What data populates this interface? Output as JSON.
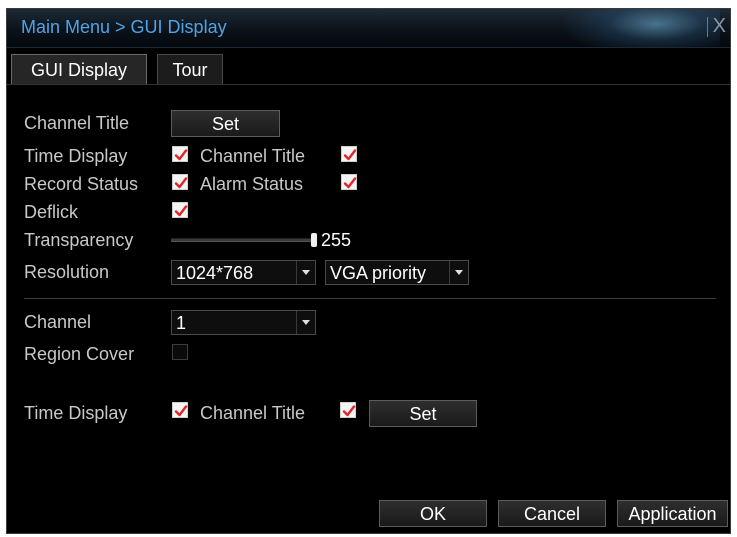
{
  "window": {
    "title": "Main Menu > GUI Display",
    "close_label": "X"
  },
  "tabs": [
    {
      "label": "GUI Display",
      "active": true
    },
    {
      "label": "Tour",
      "active": false
    }
  ],
  "global": {
    "channel_title_label": "Channel Title",
    "channel_title_button": "Set",
    "time_display_label": "Time Display",
    "time_display_checked": true,
    "channel_title_check_label": "Channel Title",
    "channel_title_checked": true,
    "record_status_label": "Record Status",
    "record_status_checked": true,
    "alarm_status_label": "Alarm Status",
    "alarm_status_checked": true,
    "deflick_label": "Deflick",
    "deflick_checked": true,
    "transparency_label": "Transparency",
    "transparency_value": "255",
    "transparency_fraction": 1.0,
    "resolution_label": "Resolution",
    "resolution_value": "1024*768",
    "output_priority_value": "VGA priority"
  },
  "per_channel": {
    "channel_label": "Channel",
    "channel_value": "1",
    "region_cover_label": "Region Cover",
    "region_cover_checked": false,
    "time_display_label": "Time Display",
    "time_display_checked": true,
    "channel_title_label": "Channel Title",
    "channel_title_checked": true,
    "set_button": "Set"
  },
  "footer": {
    "ok_label": "OK",
    "cancel_label": "Cancel",
    "apply_label": "Application"
  },
  "colors": {
    "title_text": "#4fa3e8",
    "check_mark": "#e0262a",
    "background": "#000000"
  }
}
